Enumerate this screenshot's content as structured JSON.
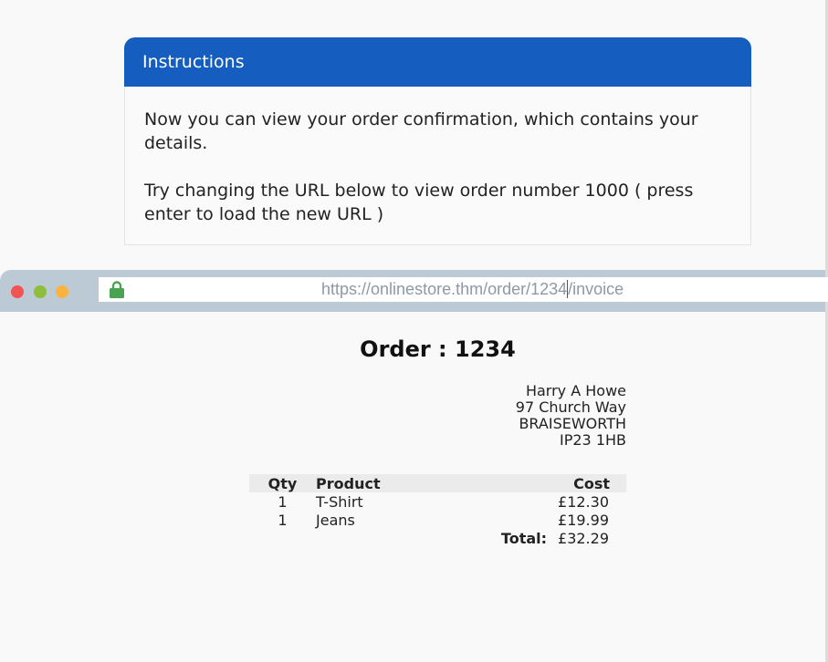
{
  "instructions": {
    "title": "Instructions",
    "paragraph1": "Now you can view your order confirmation, which contains your details.",
    "paragraph2": "Try changing the URL below to view order number 1000 ( press enter to load the new URL )"
  },
  "browser": {
    "url_before_caret": "https://onlinestore.thm/order/1234",
    "url_after_caret": "/invoice",
    "window_dots": [
      "red",
      "green",
      "yellow"
    ],
    "lock_icon": "lock-icon",
    "colors": {
      "lock": "#4aa351",
      "bar": "#bccad5"
    }
  },
  "invoice": {
    "title": "Order : 1234",
    "address": [
      "Harry A Howe",
      "97 Church Way",
      "BRAISEWORTH",
      "IP23 1HB"
    ],
    "headers": {
      "qty": "Qty",
      "product": "Product",
      "cost": "Cost"
    },
    "rows": [
      {
        "qty": "1",
        "product": "T-Shirt",
        "cost": "£12.30"
      },
      {
        "qty": "1",
        "product": "Jeans",
        "cost": "£19.99"
      }
    ],
    "total_label": "Total:",
    "total_value": "£32.29"
  },
  "colors": {
    "header": "#155dbf"
  }
}
